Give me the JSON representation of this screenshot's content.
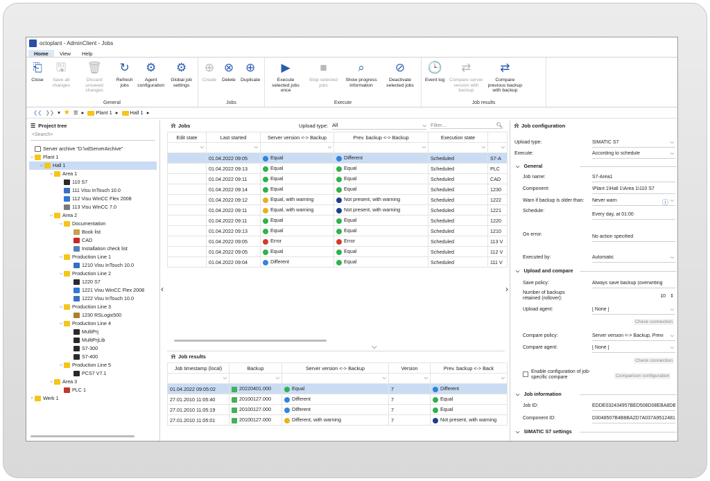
{
  "window": {
    "title": "octoplant - AdminClient - Jobs"
  },
  "menu": [
    "Home",
    "View",
    "Help"
  ],
  "ribbon": {
    "general": {
      "name": "General",
      "buttons": [
        {
          "label": "Close",
          "disabled": false
        },
        {
          "label": "Save all changes",
          "disabled": true
        },
        {
          "label": "Discard unsaved changes",
          "disabled": true
        },
        {
          "label": "Refresh jobs",
          "disabled": false
        },
        {
          "label": "Agent configuration",
          "disabled": false
        },
        {
          "label": "Global job settings",
          "disabled": false
        }
      ]
    },
    "jobs": {
      "name": "Jobs",
      "buttons": [
        {
          "label": "Create",
          "disabled": true
        },
        {
          "label": "Delete",
          "disabled": false
        },
        {
          "label": "Duplicate",
          "disabled": false
        }
      ]
    },
    "execute": {
      "name": "Execute",
      "buttons": [
        {
          "label": "Execute selected jobs once",
          "disabled": false
        },
        {
          "label": "Stop selected jobs",
          "disabled": true
        },
        {
          "label": "Show progress information",
          "disabled": false
        },
        {
          "label": "Deactivate selected jobs",
          "disabled": false
        }
      ]
    },
    "results": {
      "name": "Job results",
      "buttons": [
        {
          "label": "Event log",
          "disabled": false
        },
        {
          "label": "Compare server version with backup",
          "disabled": true
        },
        {
          "label": "Compare previous backup with backup",
          "disabled": false
        }
      ]
    }
  },
  "breadcrumb": [
    "Plant 1",
    "Hall 1"
  ],
  "project_tree": {
    "title": "Project tree",
    "search_placeholder": "<Search>",
    "items": [
      {
        "label": "Server archive \"D:\\vdServerArchive\"",
        "level": 0,
        "toggle": "",
        "icon": "archive"
      },
      {
        "label": "Plant 1",
        "level": 0,
        "toggle": "v",
        "icon": "folder"
      },
      {
        "label": "Hall 1",
        "level": 1,
        "toggle": "v",
        "icon": "folder",
        "selected": true
      },
      {
        "label": "Area 1",
        "level": 2,
        "toggle": "v",
        "icon": "folder"
      },
      {
        "label": "110 S7",
        "level": 3,
        "toggle": "",
        "icon": "s7"
      },
      {
        "label": "111 Visu InTouch 10.0",
        "level": 3,
        "toggle": "",
        "icon": "visu"
      },
      {
        "label": "112 Visu WinCC Flex 2008",
        "level": 3,
        "toggle": "",
        "icon": "wincc"
      },
      {
        "label": "113 Visu WinCC 7.0",
        "level": 3,
        "toggle": "",
        "icon": "wincc7"
      },
      {
        "label": "Area 2",
        "level": 2,
        "toggle": "v",
        "icon": "folder"
      },
      {
        "label": "Documentation",
        "level": 3,
        "toggle": "v",
        "icon": "folder"
      },
      {
        "label": "Book list",
        "level": 4,
        "toggle": "",
        "icon": "book"
      },
      {
        "label": "CAD",
        "level": 4,
        "toggle": "",
        "icon": "pdf"
      },
      {
        "label": "Installation check list",
        "level": 4,
        "toggle": "",
        "icon": "list"
      },
      {
        "label": "Production Line 1",
        "level": 3,
        "toggle": "v",
        "icon": "folder"
      },
      {
        "label": "1210 Visu InTouch 10.0",
        "level": 4,
        "toggle": "",
        "icon": "visu"
      },
      {
        "label": "Production Line 2",
        "level": 3,
        "toggle": "v",
        "icon": "folder"
      },
      {
        "label": "1220 S7",
        "level": 4,
        "toggle": "",
        "icon": "s7"
      },
      {
        "label": "1221 Visu WinCC Flex 2008",
        "level": 4,
        "toggle": "",
        "icon": "wincc"
      },
      {
        "label": "1222 Visu InTouch 10.0",
        "level": 4,
        "toggle": "",
        "icon": "visu"
      },
      {
        "label": "Production Line 3",
        "level": 3,
        "toggle": "v",
        "icon": "folder"
      },
      {
        "label": "1230 RSLogix500",
        "level": 4,
        "toggle": "",
        "icon": "rs"
      },
      {
        "label": "Production Line 4",
        "level": 3,
        "toggle": "v",
        "icon": "folder"
      },
      {
        "label": "MultiPrj",
        "level": 4,
        "toggle": "",
        "icon": "s7"
      },
      {
        "label": "MultiPrjLib",
        "level": 4,
        "toggle": "",
        "icon": "s7"
      },
      {
        "label": "S7-300",
        "level": 4,
        "toggle": "",
        "icon": "s7"
      },
      {
        "label": "S7-400",
        "level": 4,
        "toggle": "",
        "icon": "s7"
      },
      {
        "label": "Production Line 5",
        "level": 3,
        "toggle": "v",
        "icon": "folder"
      },
      {
        "label": "PCS7 V7.1",
        "level": 4,
        "toggle": "",
        "icon": "s7"
      },
      {
        "label": "Area 3",
        "level": 2,
        "toggle": "v",
        "icon": "folder"
      },
      {
        "label": "PLC 1",
        "level": 3,
        "toggle": "",
        "icon": "plc"
      },
      {
        "label": "Werk 1",
        "level": 0,
        "toggle": ">",
        "icon": "folder"
      }
    ]
  },
  "jobs": {
    "title": "Jobs",
    "upload_type_label": "Upload type:",
    "upload_type_value": "All",
    "filter_placeholder": "Filter...",
    "columns": [
      "Edit state",
      "Last started",
      "Server version <-> Backup",
      "Prev. backup <-> Backup",
      "Execution state",
      ""
    ],
    "rows": [
      {
        "last": "01.04.2022 09:05",
        "srv": "Equal",
        "srv_s": "b",
        "prev": "Different",
        "prev_s": "b",
        "exec": "Scheduled",
        "comp": "S7-A",
        "selected": true
      },
      {
        "last": "01.04.2022 09:13",
        "srv": "Equal",
        "srv_s": "g",
        "prev": "Equal",
        "prev_s": "g",
        "exec": "Scheduled",
        "comp": "PLC"
      },
      {
        "last": "01.04.2022 09:11",
        "srv": "Equal",
        "srv_s": "g",
        "prev": "Equal",
        "prev_s": "g",
        "exec": "Scheduled",
        "comp": "CAD"
      },
      {
        "last": "01.04.2022 09:14",
        "srv": "Equal",
        "srv_s": "g",
        "prev": "Equal",
        "prev_s": "g",
        "exec": "Scheduled",
        "comp": "1230"
      },
      {
        "last": "01.04.2022 09:12",
        "srv": "Equal, with warning",
        "srv_s": "y",
        "prev": "Not present, with warning",
        "prev_s": "nb",
        "exec": "Scheduled",
        "comp": "1222"
      },
      {
        "last": "01.04.2022 09:11",
        "srv": "Equal, with warning",
        "srv_s": "y",
        "prev": "Not present, with warning",
        "prev_s": "nb",
        "exec": "Scheduled",
        "comp": "1221"
      },
      {
        "last": "01.04.2022 09:11",
        "srv": "Equal",
        "srv_s": "g",
        "prev": "Equal",
        "prev_s": "g",
        "exec": "Scheduled",
        "comp": "1220"
      },
      {
        "last": "01.04.2022 09:13",
        "srv": "Equal",
        "srv_s": "g",
        "prev": "Equal",
        "prev_s": "g",
        "exec": "Scheduled",
        "comp": "1210"
      },
      {
        "last": "01.04.2022 09:05",
        "srv": "Error",
        "srv_s": "r",
        "prev": "Error",
        "prev_s": "r",
        "exec": "Scheduled",
        "comp": "113 V"
      },
      {
        "last": "01.04.2022 09:05",
        "srv": "Equal",
        "srv_s": "g",
        "prev": "Equal",
        "prev_s": "g",
        "exec": "Scheduled",
        "comp": "112 V"
      },
      {
        "last": "01.04.2022 09:04",
        "srv": "Different",
        "srv_s": "b",
        "prev": "Equal",
        "prev_s": "g",
        "exec": "Scheduled",
        "comp": "111 V"
      }
    ]
  },
  "job_results": {
    "title": "Job results",
    "columns": [
      "Job timestamp (local)",
      "Backup",
      "Server version <-> Backup",
      "Version",
      "Prev. backup <-> Back"
    ],
    "rows": [
      {
        "ts": "01.04.2022 09:05:02",
        "backup": "20220401.000",
        "srv": "Equal",
        "srv_s": "g",
        "ver": "7",
        "prev": "Different",
        "prev_s": "b",
        "selected": true
      },
      {
        "ts": "27.01.2010 11:05:40",
        "backup": "20100127.000",
        "srv": "Different",
        "srv_s": "b",
        "ver": "7",
        "prev": "Equal",
        "prev_s": "g"
      },
      {
        "ts": "27.01.2010 11:05:19",
        "backup": "20100127.000",
        "srv": "Different",
        "srv_s": "b",
        "ver": "7",
        "prev": "Equal",
        "prev_s": "g"
      },
      {
        "ts": "27.01.2010 11:05:01",
        "backup": "20100127.000",
        "srv": "Different, with warning",
        "srv_s": "y",
        "ver": "7",
        "prev": "Not present, with warning",
        "prev_s": "nb"
      }
    ]
  },
  "config": {
    "title": "Job configuration",
    "upload_type_label": "Upload type:",
    "upload_type": "SIMATIC S7",
    "execute_label": "Execute:",
    "execute": "According to schedule",
    "general": "General",
    "job_name_label": "Job name:",
    "job_name": "S7-Area1",
    "component_label": "Component:",
    "component": "\\Plant 1\\Hall 1\\Area 1\\110 S7",
    "warn_label": "Warn if backup is older than:",
    "warn": "Never warn",
    "schedule_label": "Schedule:",
    "schedule": "Every day, at 01:00",
    "on_error_label": "On error:",
    "on_error": "No action specified",
    "executed_by_label": "Executed by:",
    "executed_by": "Automatic",
    "upload_compare": "Upload and compare",
    "save_policy_label": "Save policy:",
    "save_policy": "Always save backup (overwriting",
    "retained_label": "Number of backups retained (rollover):",
    "retained": "10",
    "upload_agent_label": "Upload agent:",
    "upload_agent": "[ None ]",
    "check_connection": "Check connection",
    "compare_policy_label": "Compare policy:",
    "compare_policy": "Server version <-> Backup, Previ",
    "compare_agent_label": "Compare agent:",
    "compare_agent": "[ None ]",
    "check_connection2": "Check connection",
    "enable_label": "Enable configuration of job-specific compare",
    "comparison_config": "Comparison configuration",
    "job_info": "Job information",
    "job_id_label": "Job ID:",
    "job_id": "EDDE032434957BED508D08EBA8DBD",
    "component_id_label": "Component ID:",
    "component_id": "D3048507B4B8BA2D7A037A9512481",
    "s7_settings": "SIMATIC S7 settings"
  }
}
